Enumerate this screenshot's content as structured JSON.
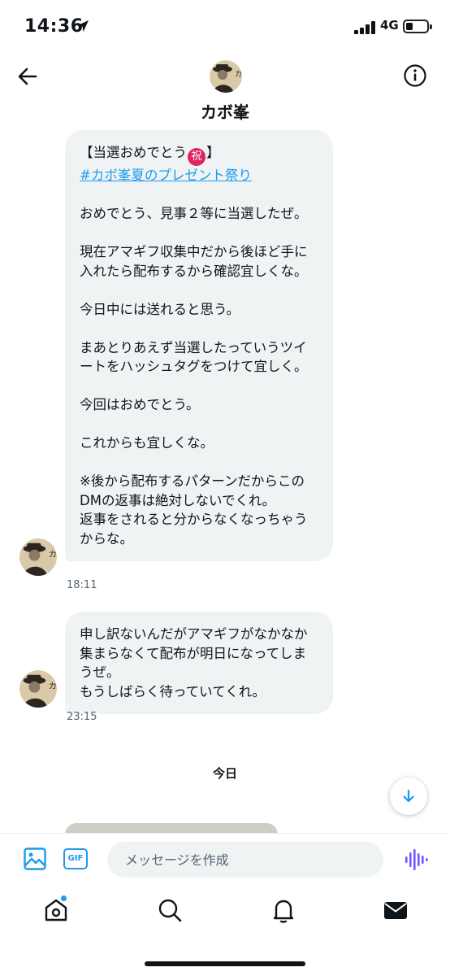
{
  "status_bar": {
    "time": "14:36",
    "network": "4G"
  },
  "header": {
    "name": "カボ峯"
  },
  "messages": [
    {
      "lines": [
        "【当選おめでとう",
        "】",
        "#カボ峯夏のプレゼント祭り",
        "",
        "おめでとう、見事２等に当選したぜ。",
        "",
        "現在アマギフ収集中だから後ほど手に",
        "入れたら配布するから確認宜しくな。",
        "",
        "今日中には送れると思う。",
        "",
        "まあとりあえず当選したっていうツイ",
        "ートをハッシュタグをつけて宜しく。",
        "",
        "今回はおめでとう。",
        "",
        "これからも宜しくな。",
        "",
        "※後から配布するパターンだからこの",
        "DMの返事は絶対しないでくれ。",
        "返事をされると分からなくなっちゃう",
        "からな。"
      ],
      "emoji": "祝",
      "timestamp": "18:11"
    },
    {
      "lines": [
        "申し訳ないんだがアマギフがなかなか",
        "集まらなくて配布が明日になってしま",
        "うぜ。",
        "もうしばらく待っていてくれ。"
      ],
      "timestamp": "23:15"
    }
  ],
  "day_separator": "今日",
  "composer": {
    "placeholder": "メッセージを作成",
    "gif_label": "GIF"
  },
  "icons": {
    "back": "arrow-left-icon",
    "info": "info-icon",
    "scroll": "arrow-down-icon",
    "image": "image-icon",
    "gif": "gif-icon",
    "voice": "voice-wave-icon",
    "home": "home-icon",
    "search": "search-icon",
    "notifications": "bell-icon",
    "messages": "envelope-icon"
  },
  "colors": {
    "accent": "#1d9bf0",
    "bubble": "#eff3f4",
    "voice": "#7856ff",
    "emoji_badge": "#e0245e"
  }
}
